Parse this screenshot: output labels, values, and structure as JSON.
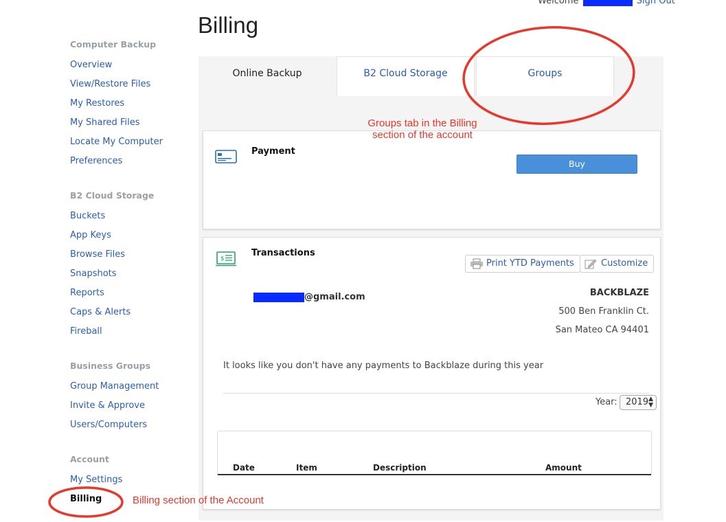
{
  "header": {
    "welcome_label": "Welcome",
    "sign_out_label": "Sign Out"
  },
  "sidebar": {
    "sections": [
      {
        "title": "Computer Backup",
        "items": [
          "Overview",
          "View/Restore Files",
          "My Restores",
          "My Shared Files",
          "Locate My Computer",
          "Preferences"
        ]
      },
      {
        "title": "B2 Cloud Storage",
        "items": [
          "Buckets",
          "App Keys",
          "Browse Files",
          "Snapshots",
          "Reports",
          "Caps & Alerts",
          "Fireball"
        ]
      },
      {
        "title": "Business Groups",
        "items": [
          "Group Management",
          "Invite & Approve",
          "Users/Computers"
        ]
      },
      {
        "title": "Account",
        "items": [
          "My Settings",
          "Billing"
        ]
      }
    ],
    "active_item": "Billing"
  },
  "page": {
    "title": "Billing",
    "tabs": [
      {
        "label": "Online Backup",
        "active": true
      },
      {
        "label": "B2 Cloud Storage",
        "active": false
      },
      {
        "label": "Groups",
        "active": false
      }
    ]
  },
  "payment": {
    "title": "Payment",
    "buy_label": "Buy"
  },
  "transactions": {
    "title": "Transactions",
    "print_label": "Print YTD Payments",
    "customize_label": "Customize",
    "email_suffix": "@gmail.com",
    "company": {
      "name": "BACKBLAZE",
      "address1": "500 Ben Franklin Ct.",
      "address2": "San Mateo CA 94401"
    },
    "notice": "It looks like you don't have any payments to Backblaze during this year",
    "year_label": "Year:",
    "year_value": "2019",
    "columns": [
      "Date",
      "Item",
      "Description",
      "Amount"
    ]
  },
  "annotations": {
    "groups_note_line1": "Groups tab in the Billing",
    "groups_note_line2": "section of the account",
    "billing_note": "Billing section of the Account"
  },
  "colors": {
    "link": "#2a5db0",
    "button": "#4a8fd9",
    "annotation": "#e8382b",
    "redaction": "#0a2bff",
    "icon_payment": "#2a6fb0",
    "icon_transactions": "#2aa06a"
  }
}
